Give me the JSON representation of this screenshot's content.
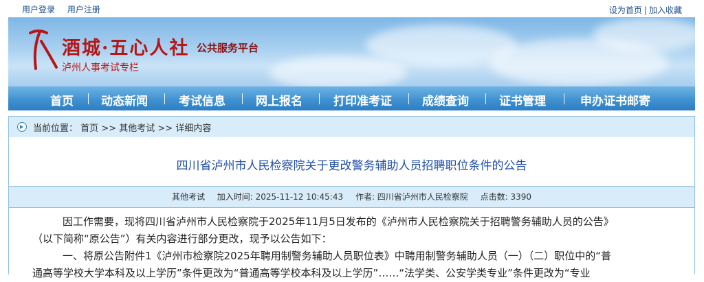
{
  "topbar": {
    "login": "用户登录",
    "register": "用户注册",
    "set_home": "设为首页",
    "separator": "|",
    "bookmark": "加入收藏"
  },
  "banner": {
    "title": "酒城·五心人社",
    "subtitle": "公共服务平台",
    "tagline": "泸州人事考试专栏"
  },
  "nav": {
    "items": [
      "首页",
      "动态新闻",
      "考试信息",
      "网上报名",
      "打印准考证",
      "成绩查询",
      "证书管理",
      "申办证书邮寄"
    ]
  },
  "breadcrumb": {
    "prefix": "当前位置：",
    "home": "首页",
    "sep1": ">>",
    "category": "其他考试",
    "sep2": ">>",
    "current": "详细内容"
  },
  "article": {
    "title": "四川省泸州市人民检察院关于更改警务辅助人员招聘职位条件的公告",
    "meta": {
      "category": "其他考试",
      "time": "加入时间: 2025-11-12 10:45:43",
      "author": "作者: 四川省泸州市人民检察院",
      "views": "点击数: 3390"
    },
    "line1": "因工作需要，现将四川省泸州市人民检察院于2025年11月5日发布的《泸州市人民检察院关于招聘警务辅助人员的公告》",
    "line2": "（以下简称“原公告”）有关内容进行部分更改，现予以公告如下：",
    "line3": "一、将原公告附件1《泸州市检察院2025年聘用制警务辅助人员职位表》中聘用制警务辅助人员（一）（二）职位中的“普",
    "line4": "通高等学校大学本科及以上学历”条件更改为“普通高等学校本科及以上学历”……“法学类、公安学类专业”条件更改为“专业"
  },
  "colors": {
    "link": "#1e4f8c",
    "nav_bg": "#3d8fd0",
    "title_blue": "#1f4ea8",
    "logo_red": "#b61616"
  }
}
